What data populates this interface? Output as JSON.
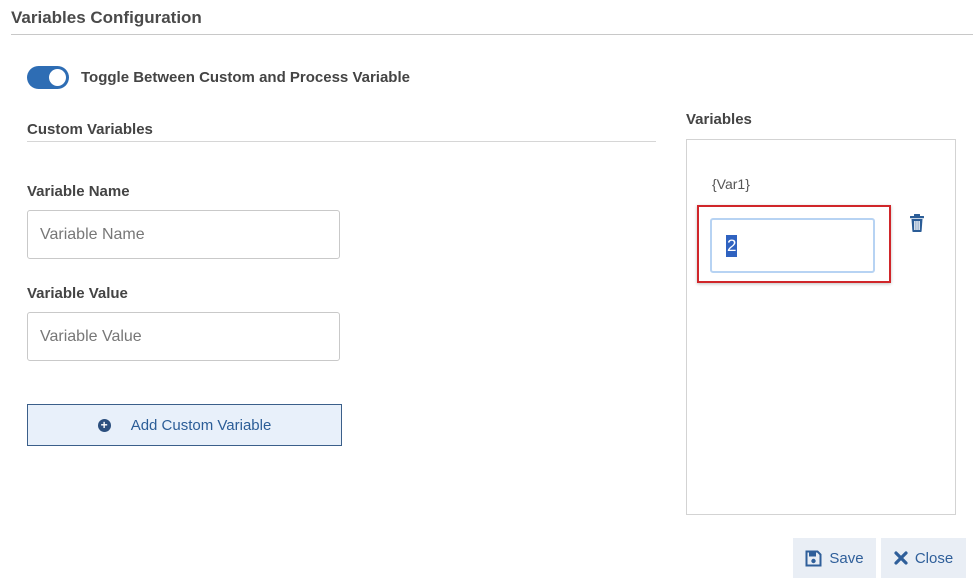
{
  "header": {
    "title": "Variables Configuration"
  },
  "toggle": {
    "label": "Toggle Between Custom and Process Variable",
    "on": true
  },
  "custom": {
    "section_title": "Custom Variables",
    "name_label": "Variable Name",
    "name_placeholder": "Variable Name",
    "value_label": "Variable Value",
    "value_placeholder": "Variable Value",
    "add_label": "Add Custom Variable"
  },
  "variables": {
    "title": "Variables",
    "items": [
      {
        "name": "{Var1}",
        "value": "2"
      }
    ]
  },
  "footer": {
    "save_label": "Save",
    "close_label": "Close"
  },
  "colors": {
    "accent": "#2e6db4",
    "highlight_border": "#d0262a"
  }
}
